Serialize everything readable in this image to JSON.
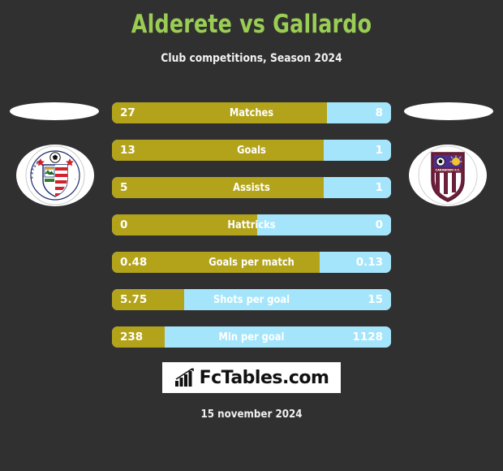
{
  "header": {
    "title": "Alderete vs Gallardo",
    "subtitle": "Club competitions, Season 2024",
    "title_color": "#9ACD54"
  },
  "teams": {
    "home": {
      "name": "Estudiantes de Merida F.C.",
      "badge_icon": "estudiantes-merida-crest"
    },
    "away": {
      "name": "Carabobo F.C.",
      "badge_icon": "carabobo-crest"
    }
  },
  "colors": {
    "background": "#303030",
    "home_bar": "#B3A31A",
    "away_bar": "#A5E5FB",
    "text": "#ffffff"
  },
  "chart_data": {
    "type": "bar",
    "title": "Alderete vs Gallardo",
    "subtitle": "Club competitions, Season 2024",
    "orientation": "horizontal-diverging",
    "series": [
      {
        "name": "Alderete",
        "color": "#B3A31A",
        "values": [
          27,
          13,
          5,
          0,
          0.48,
          5.75,
          238
        ]
      },
      {
        "name": "Gallardo",
        "color": "#A5E5FB",
        "values": [
          8,
          1,
          1,
          0,
          0.13,
          15,
          1128
        ]
      }
    ],
    "categories": [
      "Matches",
      "Goals",
      "Assists",
      "Hattricks",
      "Goals per match",
      "Shots per goal",
      "Min per goal"
    ],
    "rows": [
      {
        "label": "Matches",
        "home": "27",
        "away": "8",
        "home_pct": 77
      },
      {
        "label": "Goals",
        "home": "13",
        "away": "1",
        "home_pct": 76
      },
      {
        "label": "Assists",
        "home": "5",
        "away": "1",
        "home_pct": 76
      },
      {
        "label": "Hattricks",
        "home": "0",
        "away": "0",
        "home_pct": 52
      },
      {
        "label": "Goals per match",
        "home": "0.48",
        "away": "0.13",
        "home_pct": 74.5
      },
      {
        "label": "Shots per goal",
        "home": "5.75",
        "away": "15",
        "home_pct": 26
      },
      {
        "label": "Min per goal",
        "home": "238",
        "away": "1128",
        "home_pct": 19
      }
    ],
    "legend": [
      "Alderete",
      "Gallardo"
    ],
    "grid": false
  },
  "footer": {
    "brand": "FcTables.com",
    "brand_icon": "bar-chart-growth-icon",
    "date": "15 november 2024"
  }
}
